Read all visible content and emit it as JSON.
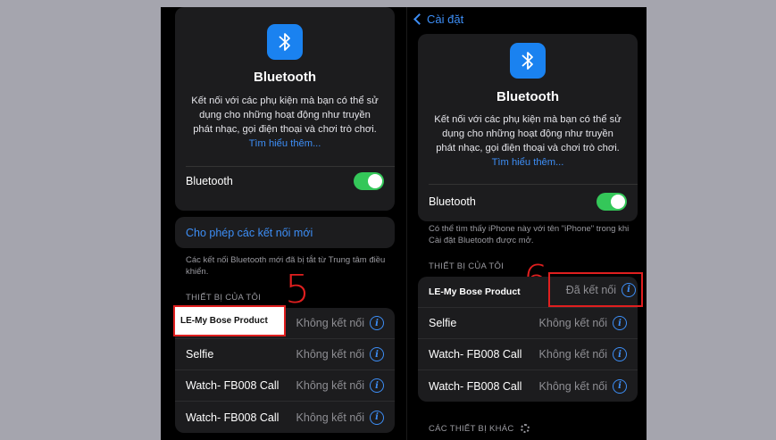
{
  "left": {
    "header": {
      "title": "Bluetooth",
      "description": "Kết nối với các phụ kiện mà bạn có thể sử dụng cho những hoạt động như truyền phát nhạc, gọi điện thoại và chơi trò chơi.",
      "learn_more": "Tìm hiểu thêm..."
    },
    "toggle_label": "Bluetooth",
    "toggle_on": true,
    "allow_connections": "Cho phép các kết nối mới",
    "allow_note": "Các kết nối Bluetooth mới đã bị tắt từ Trung tâm điều khiển.",
    "section_title": "THIẾT BỊ CỦA TÔI",
    "step_label": "5",
    "devices": [
      {
        "name": "LE-My Bose Product",
        "status": "Không kết nối"
      },
      {
        "name": "Selfie",
        "status": "Không kết nối"
      },
      {
        "name": "Watch- FB008 Call",
        "status": "Không kết nối"
      },
      {
        "name": "Watch- FB008 Call",
        "status": "Không kết nối"
      }
    ]
  },
  "right": {
    "back_label": "Cài đặt",
    "header": {
      "title": "Bluetooth",
      "description": "Kết nối với các phụ kiện mà bạn có thể sử dụng cho những hoạt động như truyền phát nhạc, gọi điện thoại và chơi trò chơi.",
      "learn_more": "Tìm hiểu thêm..."
    },
    "toggle_label": "Bluetooth",
    "toggle_on": true,
    "visible_note": "Có thể tìm thấy iPhone này với tên \"iPhone\" trong khi Cài đặt Bluetooth được mở.",
    "section_title": "THIẾT BỊ CỦA TÔI",
    "step_label": "6",
    "devices": [
      {
        "name": "LE-My Bose Product",
        "status": "Đã kết nối"
      },
      {
        "name": "Selfie",
        "status": "Không kết nối"
      },
      {
        "name": "Watch- FB008 Call",
        "status": "Không kết nối"
      },
      {
        "name": "Watch- FB008 Call",
        "status": "Không kết nối"
      }
    ],
    "other_devices_title": "CÁC THIẾT BỊ KHÁC"
  },
  "colors": {
    "accent": "#3d8ef6",
    "toggle_on": "#34c759",
    "highlight": "#e01f1f",
    "bt_icon_bg": "#1a82f0"
  },
  "icons": [
    "bluetooth-icon",
    "info-icon",
    "chevron-left-icon",
    "spinner-icon"
  ]
}
